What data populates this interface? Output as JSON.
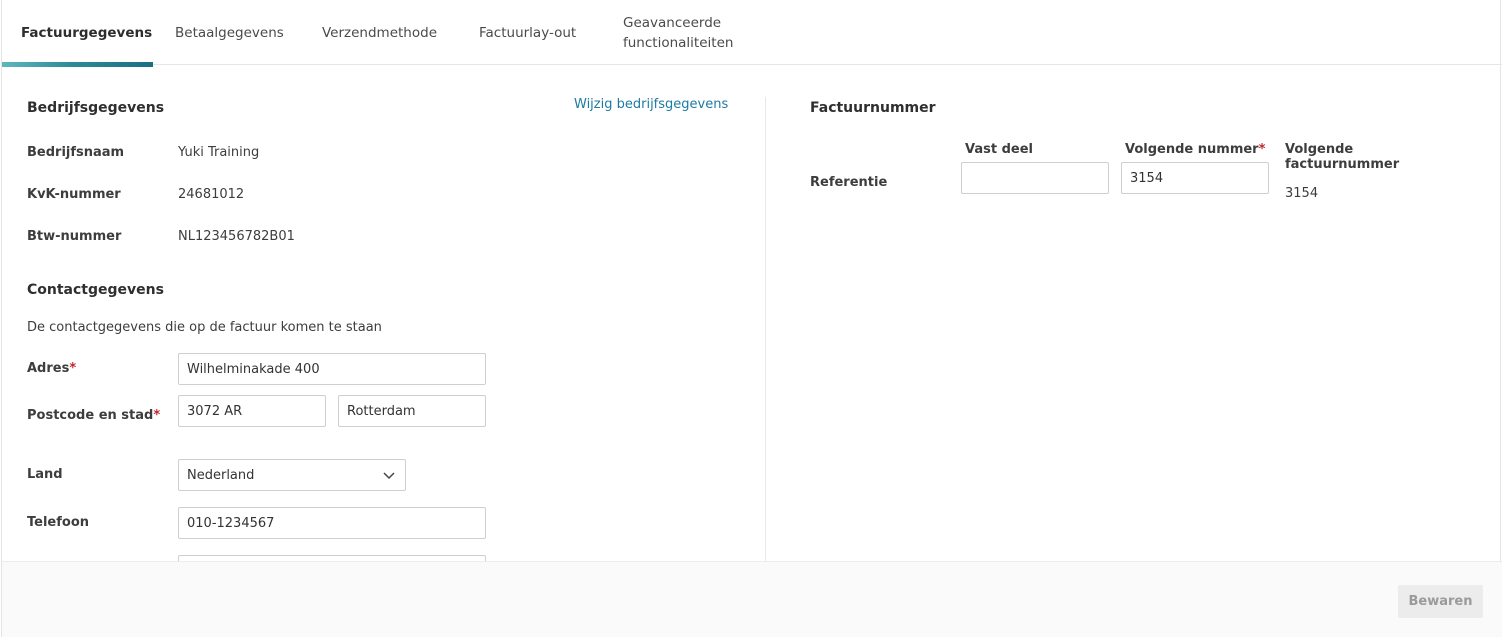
{
  "tabs": [
    {
      "label": "Factuurgegevens",
      "active": true
    },
    {
      "label": "Betaalgegevens"
    },
    {
      "label": "Verzendmethode"
    },
    {
      "label": "Factuurlay-out"
    },
    {
      "label_line1": "Geavanceerde",
      "label_line2": "functionaliteiten"
    }
  ],
  "company": {
    "title": "Bedrijfsgegevens",
    "edit_link": "Wijzig bedrijfsgegevens",
    "name_label": "Bedrijfsnaam",
    "name_value": "Yuki Training",
    "kvk_label": "KvK-nummer",
    "kvk_value": "24681012",
    "vat_label": "Btw-nummer",
    "vat_value": "NL123456782B01"
  },
  "contact": {
    "title": "Contactgegevens",
    "description": "De contactgegevens die op de factuur komen te staan",
    "address_label": "Adres",
    "address_value": "Wilhelminakade 400",
    "postal_label": "Postcode en stad",
    "postal_value": "3072 AR",
    "city_value": "Rotterdam",
    "country_label": "Land",
    "country_value": "Nederland",
    "phone_label": "Telefoon",
    "phone_value": "010-1234567",
    "required_marker": "*"
  },
  "invoice_number": {
    "title": "Factuurnummer",
    "row_label": "Referentie",
    "fixed_part_label": "Vast deel",
    "fixed_part_value": "",
    "next_number_label": "Volgende nummer",
    "next_number_value": "3154",
    "next_invoice_label_line1": "Volgende",
    "next_invoice_label_line2": "factuurnummer",
    "next_invoice_value": "3154"
  },
  "footer": {
    "save_label": "Bewaren"
  },
  "colors": {
    "accent": "#1a6f80",
    "link": "#1d7aa3",
    "required": "#c0272d"
  }
}
